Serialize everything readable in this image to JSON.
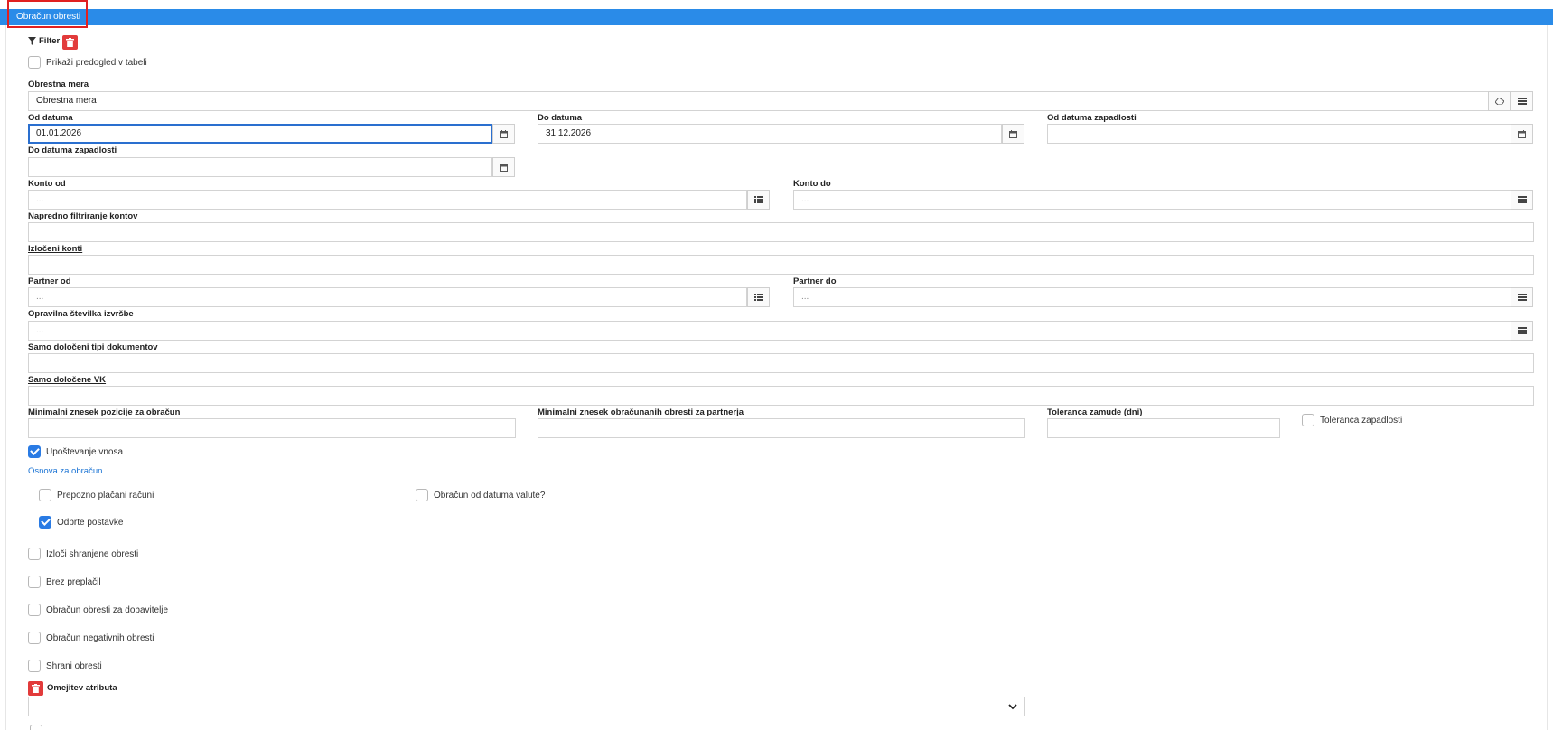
{
  "window": {
    "title": "Obračun obresti"
  },
  "filter": {
    "label": "Filter"
  },
  "preview": {
    "label": "Prikaži predogled v tabeli",
    "checked": false
  },
  "fields": {
    "obrestna_mera": {
      "label": "Obrestna mera",
      "value": "Obrestna mera"
    },
    "od_datuma": {
      "label": "Od datuma",
      "value": "01.01.2026"
    },
    "do_datuma": {
      "label": "Do datuma",
      "value": "31.12.2026"
    },
    "od_datuma_zapadlosti": {
      "label": "Od datuma zapadlosti",
      "value": ""
    },
    "do_datuma_zapadlosti": {
      "label": "Do datuma zapadlosti",
      "value": ""
    },
    "konto_od": {
      "label": "Konto od",
      "placeholder": "..."
    },
    "konto_do": {
      "label": "Konto do",
      "placeholder": "..."
    },
    "napredno_filtriranje": {
      "label": "Napredno filtriranje kontov",
      "value": ""
    },
    "izloceni_konti": {
      "label": "Izločeni konti",
      "value": ""
    },
    "partner_od": {
      "label": "Partner od",
      "placeholder": "..."
    },
    "partner_do": {
      "label": "Partner do",
      "placeholder": "..."
    },
    "opravilna_stevilka": {
      "label": "Opravilna številka izvršbe",
      "placeholder": "..."
    },
    "tipi_dokumentov": {
      "label": "Samo določeni tipi dokumentov",
      "value": ""
    },
    "dolocene_vk": {
      "label": "Samo določene VK",
      "value": ""
    },
    "min_znesek_pozicije": {
      "label": "Minimalni znesek pozicije za obračun",
      "value": ""
    },
    "min_znesek_partner": {
      "label": "Minimalni znesek obračunanih obresti za partnerja",
      "value": ""
    },
    "toleranca_zamude": {
      "label": "Toleranca zamude (dni)",
      "value": ""
    }
  },
  "checkboxes": {
    "toleranca_zapadlosti": {
      "label": "Toleranca zapadlosti",
      "checked": false
    },
    "upostevanje_vnosa": {
      "label": "Upoštevanje vnosa",
      "checked": true
    },
    "prepozno_placani": {
      "label": "Prepozno plačani računi",
      "checked": false
    },
    "obracun_od_valute": {
      "label": "Obračun od datuma valute?",
      "checked": false
    },
    "odprte_postavke": {
      "label": "Odprte postavke",
      "checked": true
    },
    "izloci_shranjene": {
      "label": "Izloči shranjene obresti",
      "checked": false
    },
    "brez_preplacil": {
      "label": "Brez preplačil",
      "checked": false
    },
    "obracun_dobavitelje": {
      "label": "Obračun obresti za dobavitelje",
      "checked": false
    },
    "obracun_negativnih": {
      "label": "Obračun negativnih obresti",
      "checked": false
    },
    "shrani_obresti": {
      "label": "Shrani obresti",
      "checked": false
    }
  },
  "osnova": {
    "label": "Osnova za obračun"
  },
  "omejitev": {
    "label": "Omejitev atributa",
    "selected": ""
  },
  "colors": {
    "accent": "#2a8be8",
    "danger": "#e23b3b",
    "check": "#2a7be4"
  }
}
